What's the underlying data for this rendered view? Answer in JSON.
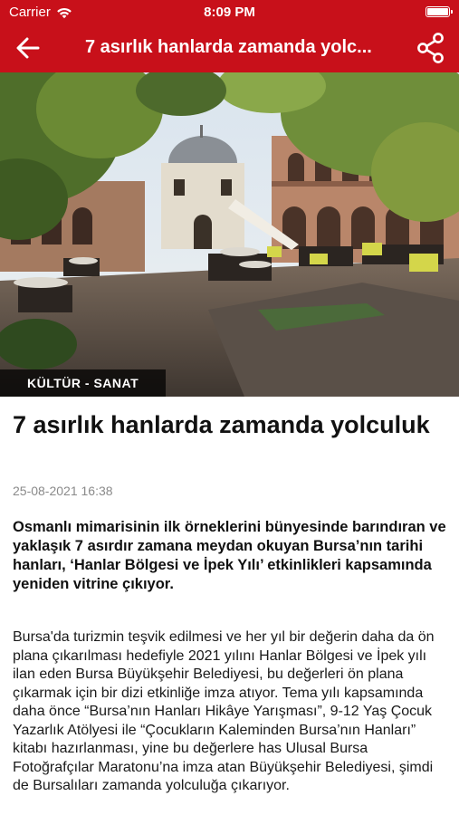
{
  "status_bar": {
    "carrier": "Carrier",
    "time": "8:09 PM",
    "wifi_icon": "wifi-icon",
    "battery_icon": "battery-icon"
  },
  "nav": {
    "back_icon": "arrow-left-icon",
    "title": "7 asırlık hanlarda zamanda yolc...",
    "share_icon": "share-icon"
  },
  "hero": {
    "category": "KÜLTÜR - SANAT"
  },
  "article": {
    "headline": "7 asırlık hanlarda zamanda yolculuk",
    "date": "25-08-2021 16:38",
    "lead": "Osmanlı mimarisinin ilk örneklerini bünyesinde barındıran ve yaklaşık 7 asırdır zamana meydan okuyan Bursa’nın tarihi hanları, ‘Hanlar Bölgesi ve İpek Yılı’ etkinlikleri kapsamında yeniden vitrine çıkıyor.",
    "body": "Bursa'da turizmin teşvik edilmesi ve her yıl bir değerin daha da ön plana çıkarılması hedefiyle 2021 yılını Hanlar Bölgesi ve İpek yılı ilan eden Bursa Büyükşehir Belediyesi, bu değerleri ön plana çıkarmak için bir dizi etkinliğe imza atıyor. Tema yılı kapsamında daha önce “Bursa’nın Hanları Hikâye Yarışması”, 9-12 Yaş Çocuk Yazarlık Atölyesi ile “Çocukların Kaleminden Bursa’nın Hanları” kitabı hazırlanması, yine bu değerlere has Ulusal Bursa Fotoğrafçılar Maratonu’na imza atan Büyükşehir Belediyesi, şimdi de Bursalıları zamanda yolculuğa çıkarıyor."
  },
  "colors": {
    "brand_red": "#c8101a",
    "date_gray": "#8a8a8a"
  }
}
